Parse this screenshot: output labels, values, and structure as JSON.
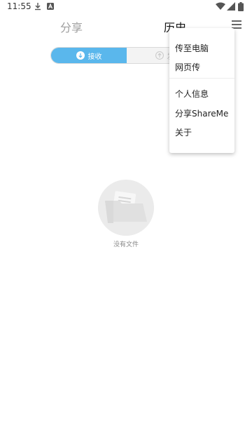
{
  "status_bar": {
    "time": "11:55",
    "icons": [
      "download-icon",
      "a-icon",
      "wifi-icon",
      "signal-icon",
      "battery-icon"
    ]
  },
  "tabs": {
    "share_label": "分享",
    "history_label": "历史"
  },
  "segment": {
    "receive_label": "接收",
    "send_label": "发"
  },
  "empty_state": {
    "text": "没有文件"
  },
  "popup_menu": {
    "items": [
      {
        "label": "传至电脑"
      },
      {
        "label": "网页传"
      },
      {
        "label": "个人信息"
      },
      {
        "label": "分享ShareMe"
      },
      {
        "label": "关于"
      }
    ]
  },
  "colors": {
    "accent": "#5ab7ec",
    "tab_inactive": "#9e9e9e",
    "tab_active": "#111111",
    "empty_circle": "#ebebeb"
  }
}
